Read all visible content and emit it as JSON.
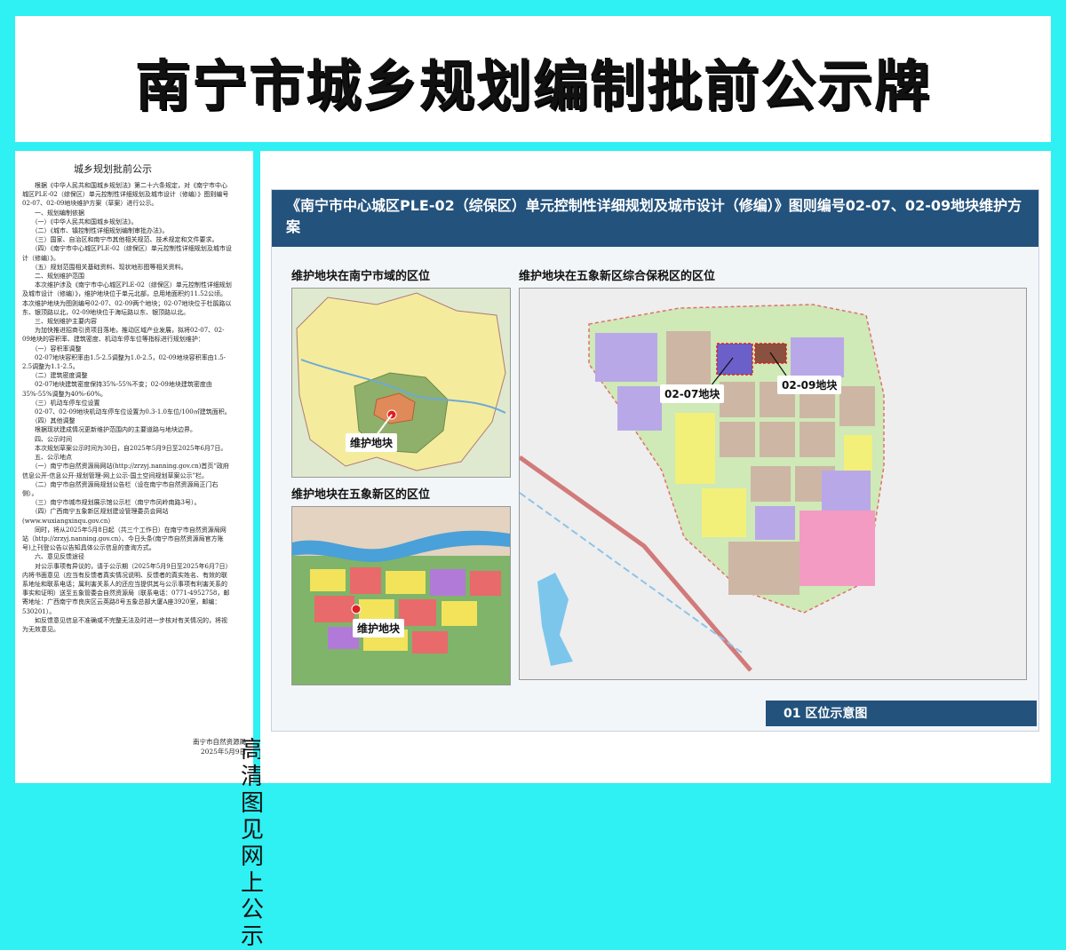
{
  "board": {
    "title": "南宁市城乡规划编制批前公示牌",
    "side_vertical_text": "高清图见网上公示"
  },
  "notice": {
    "title": "城乡规划批前公示",
    "body": "　　根据《中华人民共和国城乡规划法》第二十六条规定，对《南宁市中心城区PLE-02（综保区）单元控制性详细规划及城市设计（修编）》图则编号02-07、02-09地块维护方案（草案）进行公示。\n　　一、规划编制依据\n　　（一）《中华人民共和国城乡规划法》。\n　　（二）《城市、镇控制性详细规划编制审批办法》。\n　　（三）国家、自治区和南宁市其他相关规范、技术规定和文件要求。\n　　（四）《南宁市中心城区PLE-02（综保区）单元控制性详细规划及城市设计（修编）》。\n　　（五）规划范围相关基础资料、现状地形图等相关资料。\n　　二、规划维护范围\n　　本次维护涉及《南宁市中心城区PLE-02（综保区）单元控制性详细规划及城市设计（修编）》，维护地块位于单元北部，总用地面积约11.52公顷。本次维护地块为图则编号02-07、02-09两个地块；02-07地块位于杜鹃路以东、银顶路以北，02-09地块位于海坛路以东、银顶路以北。\n　　三、规划维护主要内容\n　　为加快推进招商引资项目落地，推动区域产业发展，拟将02-07、02-09地块的容积率、建筑密度、机动车停车位等指标进行规划维护：\n　　（一）容积率调整\n　　02-07地块容积率由1.5-2.5调整为1.0-2.5，02-09地块容积率由1.5-2.5调整为1.1-2.5。\n　　（二）建筑密度调整\n　　02-07地块建筑密度保持35%-55%不变；02-09地块建筑密度由35%-55%调整为40%-60%。\n　　（三）机动车停车位设置\n　　02-07、02-09地块机动车停车位设置为0.3-1.0车位/100㎡建筑面积。\n　　（四）其他调整\n　　根据现状建成情况更新维护范围内的主要道路与地块边界。\n　　四、公示时间\n　　本次规划草案公示时间为30日，自2025年5月9日至2025年6月7日。\n　　五、公示地点\n　　（一）南宁市自然资源局网站(http://zrzyj.nanning.gov.cn)首页“政府信息公开-信息公开-规划管理-网上公示-国土空间规划草案公示”栏。\n　　（二）南宁市自然资源局规划公告栏（设在南宁市自然资源局正门右侧）。\n　　（三）南宁市城市规划展示馆公示栏（南宁市凤岭南路3号）。\n　　（四）广西南宁五象新区规划建设管理委员会网站(www.wuxiangxinqu.gov.cn)\n　　同时，将从2025年5月8日起（共三个工作日）在南宁市自然资源局网站（http://zrzyj.nanning.gov.cn）、今日头条(南宁市自然资源局官方账号)上刊登公告以告知具体公示信息的查询方式。\n　　六、意见反馈途径\n　　对公示事项有异议的，请于公示期（2025年5月9日至2025年6月7日）内将书面意见（应当有反馈者真实情况说明、反馈者的真实姓名、有效的联系地址和联系电话；属利害关系人的还应当提供其与公示事项有利害关系的事实和证明）送至五象管委会自然资源局（联系电话：0771-4952758，邮寄地址：广西南宁市良庆区云英路8号五象总部大厦A座3920室，邮编：530201）。\n　　如反馈意见信息不准确或不完整无法及时进一步核对有关情况的，将视为无效意见。",
    "signature_org": "南宁市自然资源局",
    "signature_date": "2025年5月9日"
  },
  "sheet": {
    "title": "《南宁市中心城区PLE-02（综保区）单元控制性详细规划及城市设计（修编）》图则编号02-07、02-09地块维护方案",
    "caption_city": "维护地块在南宁市域的区位",
    "caption_wuxiang": "维护地块在五象新区的区位",
    "caption_bonded": "维护地块在五象新区综合保税区的区位",
    "label_parcel": "维护地块",
    "label_0207": "02-07地块",
    "label_0209": "02-09地块",
    "footer": "01 区位示意图"
  },
  "colors": {
    "board_bg": "#2ff0f2",
    "header_blue": "#23527c",
    "parcel_purple": "#b9a8e8",
    "parcel_tan": "#cdb6a4",
    "parcel_yellow": "#f3f07a",
    "parcel_pink": "#f39bc2",
    "parcel_green": "#cfe9b7"
  },
  "icons": [
    "location-pin-icon",
    "pointer-line-icon"
  ]
}
